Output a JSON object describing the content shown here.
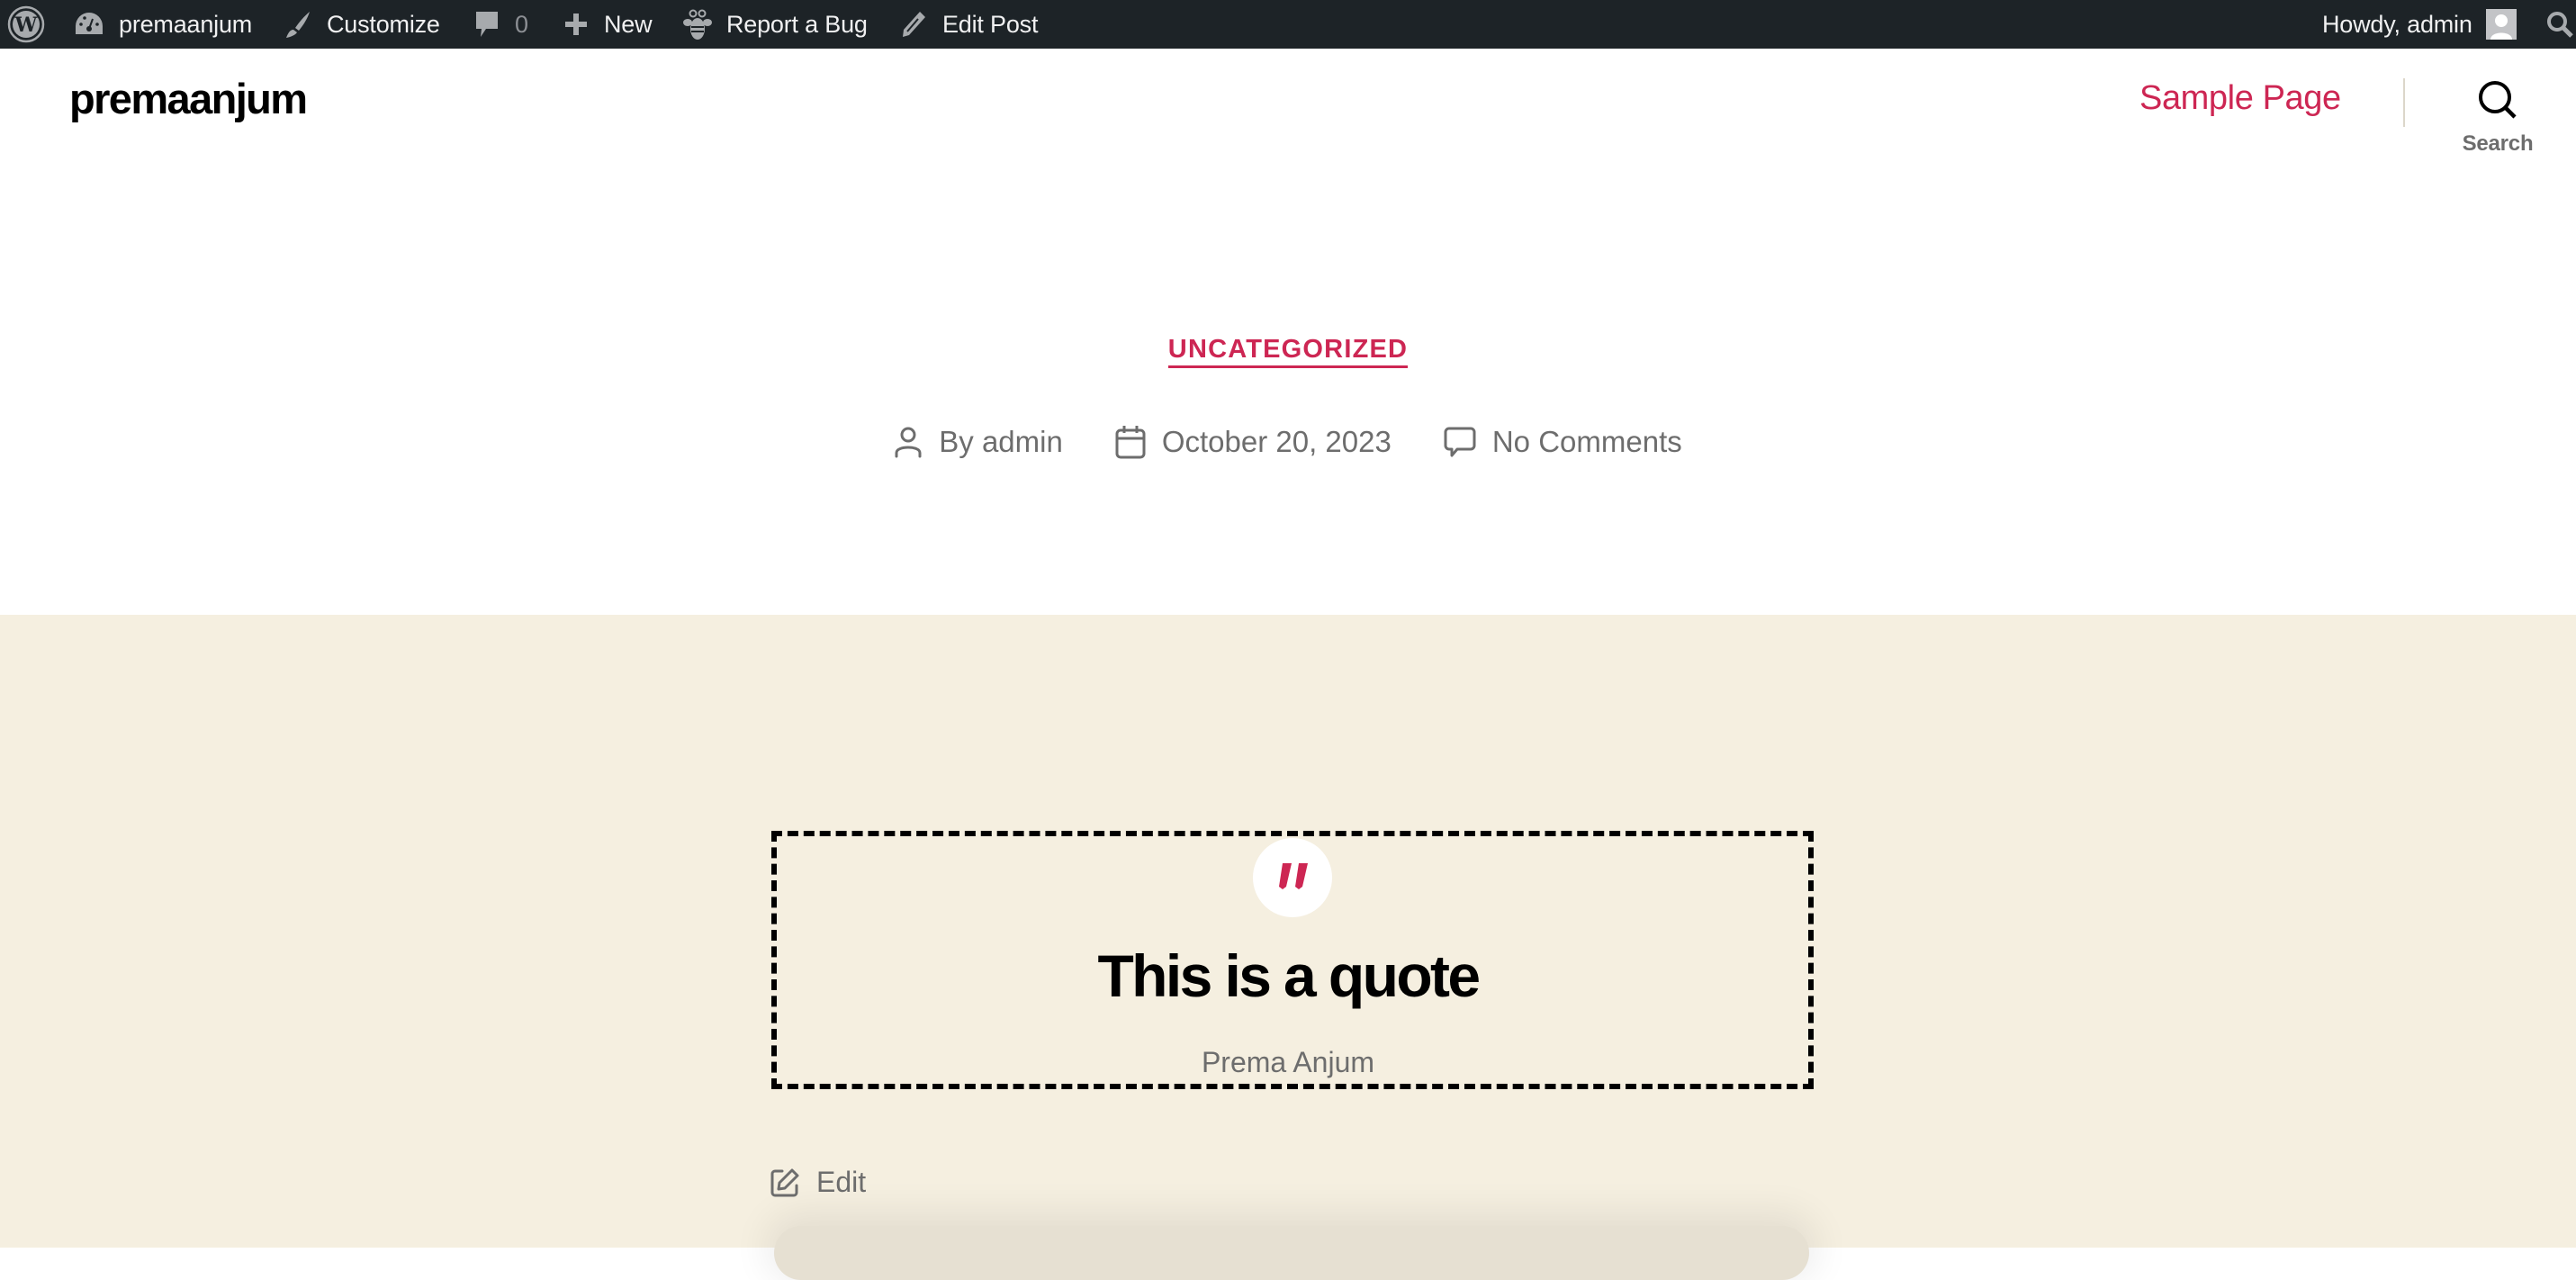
{
  "admin_bar": {
    "wp_logo_icon": "wordpress-logo-icon",
    "items": [
      {
        "icon": "dashboard-icon",
        "label": "premaanjum"
      },
      {
        "icon": "brush-icon",
        "label": "Customize"
      },
      {
        "icon": "comment-icon",
        "label": "0"
      },
      {
        "icon": "plus-icon",
        "label": "New"
      },
      {
        "icon": "bug-icon",
        "label": "Report a Bug"
      },
      {
        "icon": "pencil-icon",
        "label": "Edit Post"
      }
    ],
    "account": {
      "label": "Howdy, admin",
      "avatar_icon": "avatar-icon"
    },
    "search_icon": "search-icon"
  },
  "header": {
    "site_title": "premaanjum",
    "nav": [
      {
        "label": "Sample Page"
      }
    ],
    "search_label": "Search"
  },
  "entry": {
    "category": "UNCATEGORIZED",
    "meta": {
      "author": "By admin",
      "date": "October 20, 2023",
      "comments": "No Comments"
    }
  },
  "quote": {
    "text": "This is a quote",
    "citation": "Prema Anjum",
    "icon": "quote-icon"
  },
  "edit_link": {
    "label": "Edit"
  },
  "colors": {
    "accent": "#cd2653",
    "admin_bar_bg": "#1d2327",
    "content_bg": "#f5efe0",
    "meta_text": "#6d6d6d"
  }
}
